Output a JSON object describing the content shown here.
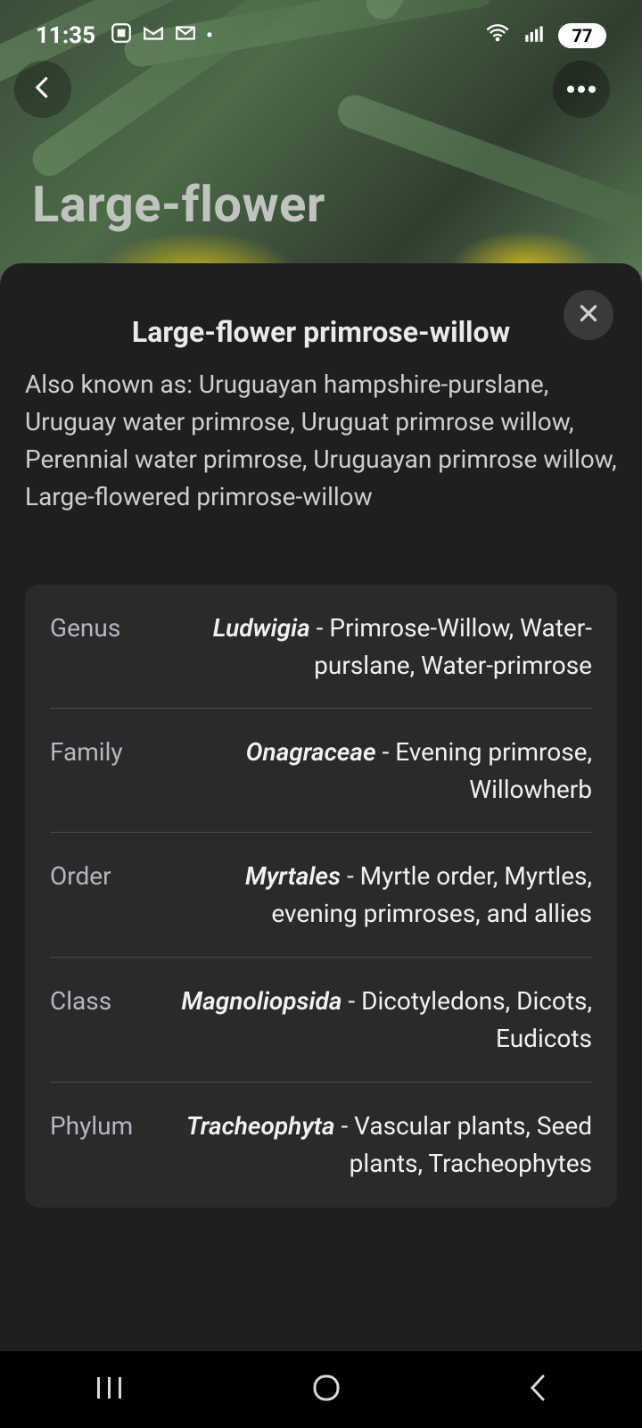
{
  "status": {
    "time": "11:35",
    "battery": "77"
  },
  "header_bg": {
    "title": "Large-flower"
  },
  "sheet": {
    "title": "Large-flower primrose-willow",
    "also_known_as": "Also known as: Uruguayan hampshire-purslane, Uruguay water primrose, Uruguat primrose willow, Perennial water primrose, Uruguayan primrose willow, Large-flowered primrose-willow",
    "taxonomy": [
      {
        "label": "Genus",
        "scientific": "Ludwigia",
        "common": " - Primrose-Willow, Water-purslane, Water-primrose"
      },
      {
        "label": "Family",
        "scientific": "Onagraceae",
        "common": " - Evening primrose, Willowherb"
      },
      {
        "label": "Order",
        "scientific": "Myrtales",
        "common": " - Myrtle order, Myrtles, evening primroses, and allies"
      },
      {
        "label": "Class",
        "scientific": "Magnoliopsida",
        "common": " - Dicotyledons, Dicots, Eudicots"
      },
      {
        "label": "Phylum",
        "scientific": "Tracheophyta",
        "common": " - Vascular plants, Seed plants, Tracheophytes"
      }
    ]
  },
  "icons": {
    "back": "chevron-left-icon",
    "more": "more-horizontal-icon",
    "close": "close-icon",
    "nav_recent": "recent-apps-icon",
    "nav_home": "home-icon",
    "nav_back": "back-icon"
  },
  "colors": {
    "sheet_bg": "#1f1f20",
    "card_bg": "#2a2a2c",
    "text_primary": "#f1f1f3",
    "text_secondary": "#b7b7bb"
  }
}
